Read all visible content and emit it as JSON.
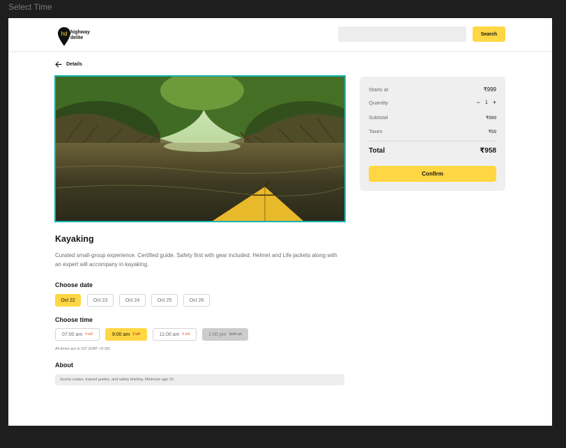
{
  "window": {
    "title": "Select Time"
  },
  "header": {
    "logo_line1": "highway",
    "logo_line2": "delite",
    "logo_mark": "hd",
    "search_placeholder": "",
    "search_button": "Search"
  },
  "nav": {
    "back_label": "Details"
  },
  "experience": {
    "title": "Kayaking",
    "description": "Curated small-group experience. Certified guide. Safety first with gear included. Helmet and Life jackets along with an expert will accompany in kayaking."
  },
  "date_section": {
    "label": "Choose date",
    "dates": [
      "Oct 22",
      "Oct 23",
      "Oct 24",
      "Oct 25",
      "Oct 26"
    ],
    "selected": "Oct 22"
  },
  "time_section": {
    "label": "Choose time",
    "slots": [
      {
        "time": "07:00 am",
        "status": "4 left"
      },
      {
        "time": "9:00 am",
        "status": "2 left"
      },
      {
        "time": "11:00 am",
        "status": "5 left"
      },
      {
        "time": "1:00 pm",
        "status": "Sold out"
      }
    ],
    "selected": "9:00 am",
    "note": "All times are in IST (GMT +5:30)"
  },
  "about": {
    "label": "About",
    "text": "Scenic routes, trained guides, and safety briefing. Minimum age 10."
  },
  "summary": {
    "starts_at_label": "Starts at",
    "starts_at_value": "₹999",
    "quantity_label": "Quantity",
    "quantity_minus": "−",
    "quantity_value": "1",
    "quantity_plus": "+",
    "subtotal_label": "Subtotal",
    "subtotal_value": "₹999",
    "taxes_label": "Taxes",
    "taxes_value": "₹59",
    "total_label": "Total",
    "total_value": "₹958",
    "confirm_label": "Confirm"
  },
  "colors": {
    "accent": "#ffd643",
    "image_border": "#14b3b0",
    "frame_bg": "#1e1e1e",
    "left_badge": "#ee5b2d"
  },
  "icons": [
    "location-pin-icon",
    "arrow-left-icon"
  ]
}
